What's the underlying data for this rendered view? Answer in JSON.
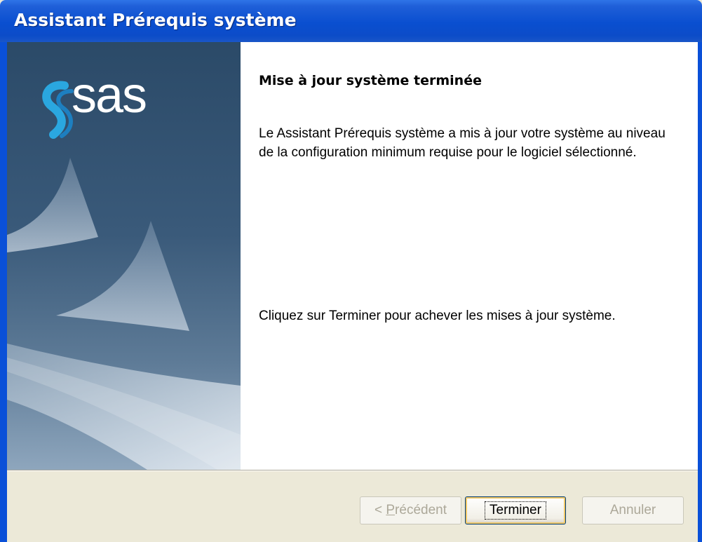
{
  "window": {
    "title": "Assistant Prérequis système"
  },
  "banner": {
    "logo_text": "sas",
    "logo_icon": "sas-swirl-icon"
  },
  "content": {
    "heading": "Mise à jour système terminée",
    "paragraph1": "Le Assistant Prérequis système a mis à jour votre système au niveau de la configuration minimum requise pour le logiciel sélectionné.",
    "paragraph2": "Cliquez sur Terminer pour achever les mises à jour système."
  },
  "buttons": {
    "previous_prefix": "< ",
    "previous_mnemonic": "P",
    "previous_rest": "récédent",
    "finish": "Terminer",
    "cancel": "Annuler"
  },
  "colors": {
    "titlebar": "#0a50d8",
    "banner": "#3a5a7a",
    "dialog_background": "#ece9d8",
    "disabled_text": "#aca899"
  }
}
